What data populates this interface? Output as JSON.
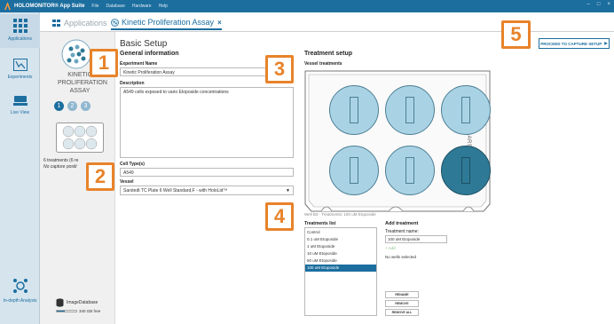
{
  "titlebar": {
    "app_name": "HOLOMONITOR® App Suite",
    "menu": [
      "File",
      "Database",
      "Hardware",
      "Help"
    ],
    "win_min": "–",
    "win_max": "□",
    "win_close": "×"
  },
  "sidebar": {
    "items": [
      {
        "label": "Applications",
        "icon": "grid-icon"
      },
      {
        "label": "Experiments",
        "icon": "chart-icon"
      },
      {
        "label": "Live View",
        "icon": "microscope-icon"
      },
      {
        "label": "In-depth Analysis",
        "icon": "analysis-icon"
      }
    ]
  },
  "tabs": [
    {
      "label": "Applications",
      "active": false
    },
    {
      "label": "Kinetic Proliferation Assay",
      "active": true
    }
  ],
  "left_panel": {
    "assay_name": "KINETIC PROLIFERATION ASSAY",
    "steps": [
      "1",
      "2",
      "3"
    ],
    "treatments_summary": "6 treatments (6 re",
    "capture_summary": "No capture positi",
    "storage_label": "ImageDatabase",
    "storage_free": "340 GB free"
  },
  "main": {
    "page_title": "Basic Setup",
    "general_title": "General information",
    "experiment_name_label": "Experiment Name",
    "experiment_name_value": "Kinetic Proliferation Assay",
    "description_label": "Description",
    "description_value": "A549 cells exposed to vario Etoposide concentrations",
    "cell_types_label": "Cell Type(s)",
    "cell_types_value": "A549",
    "vessel_label": "Vessel",
    "vessel_value": "Sarstedt TC Plate 6 Well Standard,F - with HoloLid™",
    "treatment_title": "Treatment setup",
    "vessel_treatments_label": "Vessel treatments",
    "plate_brand": "SARSTEDT",
    "well_caption": "Well B3 - Treatments: 100 uM Etoposide",
    "treatments_list_label": "Treatments list",
    "treatments": [
      "Control",
      "0.1 uM Etoposide",
      "1 uM Etoposide",
      "10 uM Etoposide",
      "50 uM Etoposide",
      "100 uM Etoposide"
    ],
    "selected_treatment_index": 5,
    "add_treatment_label": "Add treatment",
    "treatment_name_label": "Treatment name:",
    "treatment_name_value": "100 uM Etoposide",
    "add_button": "+ Add",
    "no_wells": "No wells selected",
    "rename_button": "RENAME",
    "remove_button": "REMOVE",
    "remove_all_button": "REMOVE ALL",
    "proceed_button": "PROCEED TO CAPTURE SETUP"
  },
  "callouts": [
    "1",
    "2",
    "3",
    "4",
    "5"
  ],
  "colors": {
    "brand": "#1c6e9f",
    "callout": "#e8832a",
    "well_light": "#a9d3e4",
    "well_dark": "#2e7a96"
  }
}
